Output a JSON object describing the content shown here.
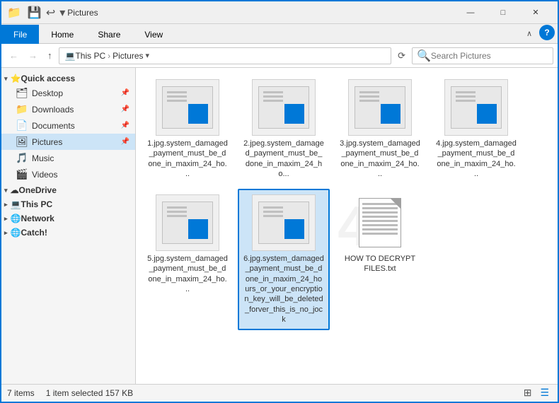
{
  "titleBar": {
    "title": "Pictures",
    "quickSaveIcon": "💾",
    "undoIcon": "↩",
    "dropdownIcon": "▾",
    "minimizeLabel": "—",
    "maximizeLabel": "□",
    "closeLabel": "✕"
  },
  "ribbon": {
    "tabs": [
      {
        "label": "File",
        "active": true,
        "id": "file"
      },
      {
        "label": "Home",
        "active": false,
        "id": "home"
      },
      {
        "label": "Share",
        "active": false,
        "id": "share"
      },
      {
        "label": "View",
        "active": false,
        "id": "view"
      }
    ],
    "collapseLabel": "∧",
    "helpLabel": "?"
  },
  "addressBar": {
    "backLabel": "←",
    "forwardLabel": "→",
    "upLabel": "↑",
    "pathItems": [
      "This PC",
      "Pictures"
    ],
    "dropdownLabel": "▾",
    "refreshLabel": "⟳",
    "searchPlaceholder": "Search Pictures",
    "searchIconLabel": "🔍"
  },
  "sidebar": {
    "quickAccessLabel": "Quick access",
    "items": [
      {
        "label": "Desktop",
        "icon": "🗂",
        "pinned": true,
        "id": "desktop"
      },
      {
        "label": "Downloads",
        "icon": "📁",
        "pinned": true,
        "id": "downloads"
      },
      {
        "label": "Documents",
        "icon": "📄",
        "pinned": true,
        "id": "documents"
      },
      {
        "label": "Pictures",
        "icon": "🖼",
        "pinned": true,
        "id": "pictures",
        "active": true
      },
      {
        "label": "Music",
        "icon": "🎵",
        "pinned": false,
        "id": "music"
      },
      {
        "label": "Videos",
        "icon": "🎬",
        "pinned": false,
        "id": "videos"
      }
    ],
    "oneDriveLabel": "OneDrive",
    "oneDriveIcon": "☁",
    "thisPCLabel": "This PC",
    "thisPCIcon": "💻",
    "networkLabel": "Network",
    "networkIcon": "🌐",
    "catchLabel": "Catch!",
    "catchIcon": "🌐"
  },
  "files": [
    {
      "id": "file1",
      "name": "1.jpg.system_damaged_payment_must_be_done_in_maxim_24_ho...",
      "type": "jpg-damaged",
      "selected": false
    },
    {
      "id": "file2",
      "name": "2.jpeg.system_damaged_payment_must_be_done_in_maxim_24_ho...",
      "type": "jpg-damaged",
      "selected": false
    },
    {
      "id": "file3",
      "name": "3.jpg.system_damaged_payment_must_be_done_in_maxim_24_ho...",
      "type": "jpg-damaged",
      "selected": false
    },
    {
      "id": "file4",
      "name": "4.jpg.system_damaged_payment_must_be_done_in_maxim_24_ho...",
      "type": "jpg-damaged",
      "selected": false
    },
    {
      "id": "file5",
      "name": "5.jpg.system_damaged_payment_must_be_done_in_maxim_24_ho...",
      "type": "jpg-damaged",
      "selected": false
    },
    {
      "id": "file6",
      "name": "6.jpg.system_damaged_payment_must_be_done_in_maxim_24_hours_or_your_encryption_key_will_be_deleted_forver_this_is_no_jock",
      "type": "jpg-damaged",
      "selected": true
    },
    {
      "id": "file7",
      "name": "HOW TO DECRYPT FILES.txt",
      "type": "txt",
      "selected": false
    }
  ],
  "statusBar": {
    "itemCount": "7 items",
    "selectedInfo": "1 item selected  157 KB",
    "gridViewLabel": "⊞",
    "listViewLabel": "☰"
  },
  "watermark": "47"
}
